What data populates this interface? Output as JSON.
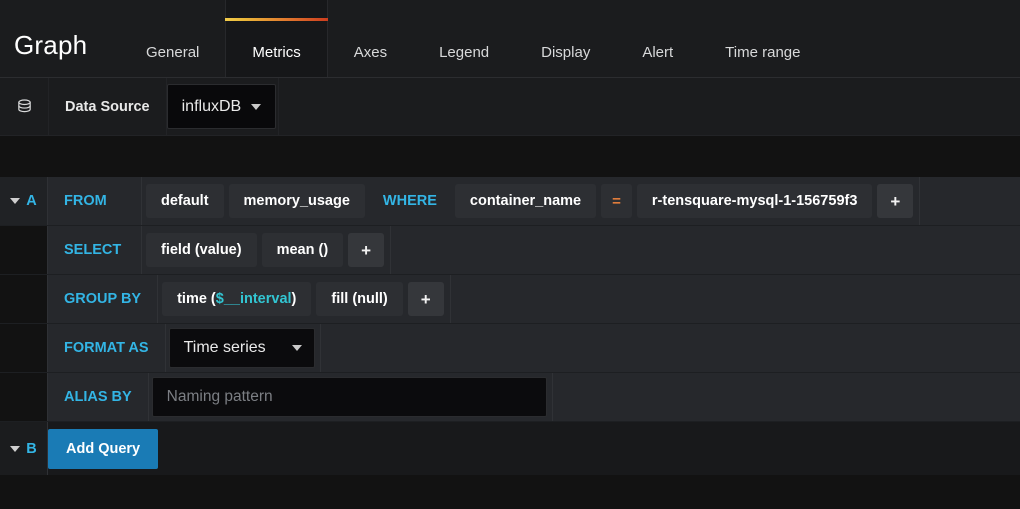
{
  "header": {
    "panel_title": "Graph",
    "tabs": [
      {
        "label": "General",
        "active": false
      },
      {
        "label": "Metrics",
        "active": true
      },
      {
        "label": "Axes",
        "active": false
      },
      {
        "label": "Legend",
        "active": false
      },
      {
        "label": "Display",
        "active": false
      },
      {
        "label": "Alert",
        "active": false
      },
      {
        "label": "Time range",
        "active": false
      }
    ],
    "active_tab_accent_from": "#eab839",
    "active_tab_accent_to": "#cc3d1e"
  },
  "datasource": {
    "icon": "database-icon",
    "label": "Data Source",
    "value": "influxDB",
    "dropdown_icon": "chevron-down-icon"
  },
  "query": {
    "letter": "A",
    "collapse_icon": "caret-down-icon",
    "from": {
      "keyword": "FROM",
      "policy": "default",
      "measurement": "memory_usage",
      "where_keyword": "WHERE",
      "tag_key": "container_name",
      "operator": "=",
      "tag_value": "r-tensquare-mysql-1-156759f3",
      "add_label": "+"
    },
    "select": {
      "keyword": "SELECT",
      "field": "field (value)",
      "aggregate": "mean ()",
      "add_label": "+"
    },
    "group_by": {
      "keyword": "GROUP BY",
      "time_prefix": "time (",
      "time_variable": "$__interval",
      "time_suffix": ")",
      "fill": "fill (null)",
      "add_label": "+"
    },
    "format_as": {
      "keyword": "FORMAT AS",
      "value": "Time series",
      "dropdown_icon": "chevron-down-icon"
    },
    "alias_by": {
      "keyword": "ALIAS BY",
      "value": "",
      "placeholder": "Naming pattern"
    }
  },
  "next_query": {
    "letter": "B",
    "collapse_icon": "caret-down-icon",
    "add_query_label": "Add Query",
    "add_query_color": "#1a7bb5"
  }
}
